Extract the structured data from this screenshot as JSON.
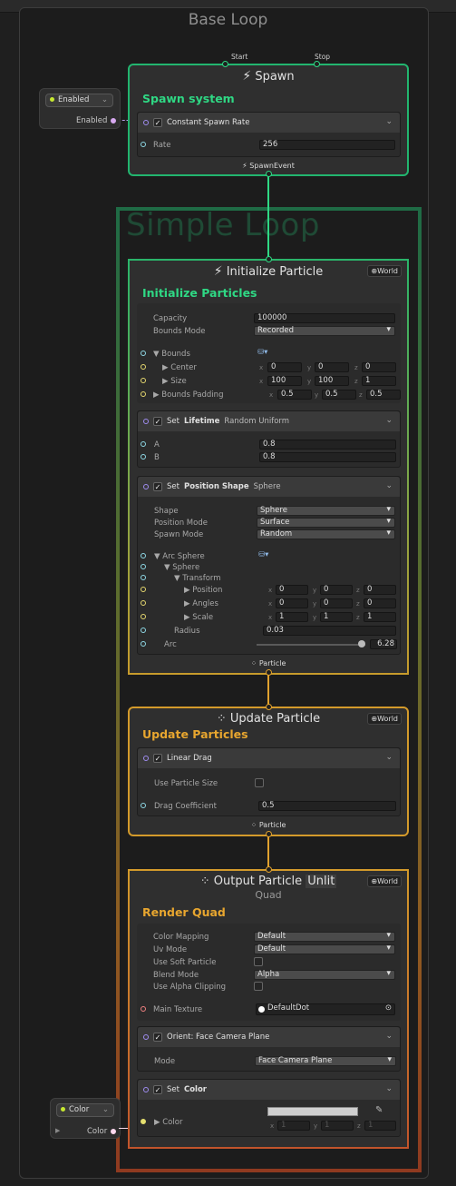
{
  "system": {
    "title": "Base Loop",
    "subtitle": "Simple Loop"
  },
  "spawn": {
    "ports": {
      "start": "Start",
      "stop": "Stop"
    },
    "title": "Spawn",
    "subtitle": "Spawn system",
    "block": {
      "label": "Constant Spawn Rate",
      "enabled": true
    },
    "rate_label": "Rate",
    "rate_value": "256",
    "footer": "SpawnEvent"
  },
  "enabled_node": {
    "pill": "Enabled",
    "label": "Enabled"
  },
  "init": {
    "title": "Initialize Particle",
    "space": "World",
    "subtitle": "Initialize Particles",
    "capacity_label": "Capacity",
    "capacity_value": "100000",
    "bounds_mode_label": "Bounds Mode",
    "bounds_mode_value": "Recorded",
    "bounds_label": "Bounds",
    "center_label": "Center",
    "size_label": "Size",
    "padding_label": "Bounds Padding",
    "center": {
      "x": "0",
      "y": "0",
      "z": "0"
    },
    "size": {
      "x": "100",
      "y": "100",
      "z": "1"
    },
    "padding": {
      "x": "0.5",
      "y": "0.5",
      "z": "0.5"
    },
    "lifetime": {
      "set": "Set",
      "attr": "Lifetime",
      "mode": "Random Uniform",
      "a_label": "A",
      "a": "0.8",
      "b_label": "B",
      "b": "0.8"
    },
    "position": {
      "set": "Set",
      "attr": "Position Shape",
      "shape_name": "Sphere",
      "shape_label": "Shape",
      "shape_value": "Sphere",
      "pos_mode_label": "Position Mode",
      "pos_mode_value": "Surface",
      "spawn_mode_label": "Spawn Mode",
      "spawn_mode_value": "Random",
      "arc_sphere": "Arc Sphere",
      "sphere": "Sphere",
      "transform": "Transform",
      "position_label": "Position",
      "angles_label": "Angles",
      "scale_label": "Scale",
      "position": {
        "x": "0",
        "y": "0",
        "z": "0"
      },
      "angles": {
        "x": "0",
        "y": "0",
        "z": "0"
      },
      "scale": {
        "x": "1",
        "y": "1",
        "z": "1"
      },
      "radius_label": "Radius",
      "radius": "0.03",
      "arc_label": "Arc",
      "arc": "6.28",
      "arc_fraction": 0.97
    },
    "footer": "Particle"
  },
  "update": {
    "title": "Update Particle",
    "space": "World",
    "subtitle": "Update Particles",
    "block": "Linear Drag",
    "use_size_label": "Use Particle Size",
    "drag_label": "Drag Coefficient",
    "drag_value": "0.5",
    "footer": "Particle"
  },
  "output": {
    "title": "Output Particle",
    "title_tag": "Unlit",
    "title2": "Quad",
    "space": "World",
    "subtitle": "Render Quad",
    "color_mapping_label": "Color Mapping",
    "color_mapping_value": "Default",
    "uv_mode_label": "Uv Mode",
    "uv_mode_value": "Default",
    "soft_label": "Use Soft Particle",
    "blend_label": "Blend Mode",
    "blend_value": "Alpha",
    "alpha_clip_label": "Use Alpha Clipping",
    "main_tex_label": "Main Texture",
    "main_tex_value": "DefaultDot",
    "orient": {
      "label": "Orient: Face Camera Plane",
      "mode_label": "Mode",
      "mode_value": "Face Camera Plane"
    },
    "setcolor": {
      "set": "Set",
      "attr": "Color",
      "color_label": "Color",
      "x": "1",
      "y": "1",
      "z": "1"
    }
  },
  "color_node": {
    "pill": "Color",
    "label": "Color"
  },
  "axes": {
    "x": "x",
    "y": "y",
    "z": "z"
  },
  "colors": {
    "spawn": "#22b56f",
    "update": "#d39a2b",
    "output": "#c2542b"
  }
}
